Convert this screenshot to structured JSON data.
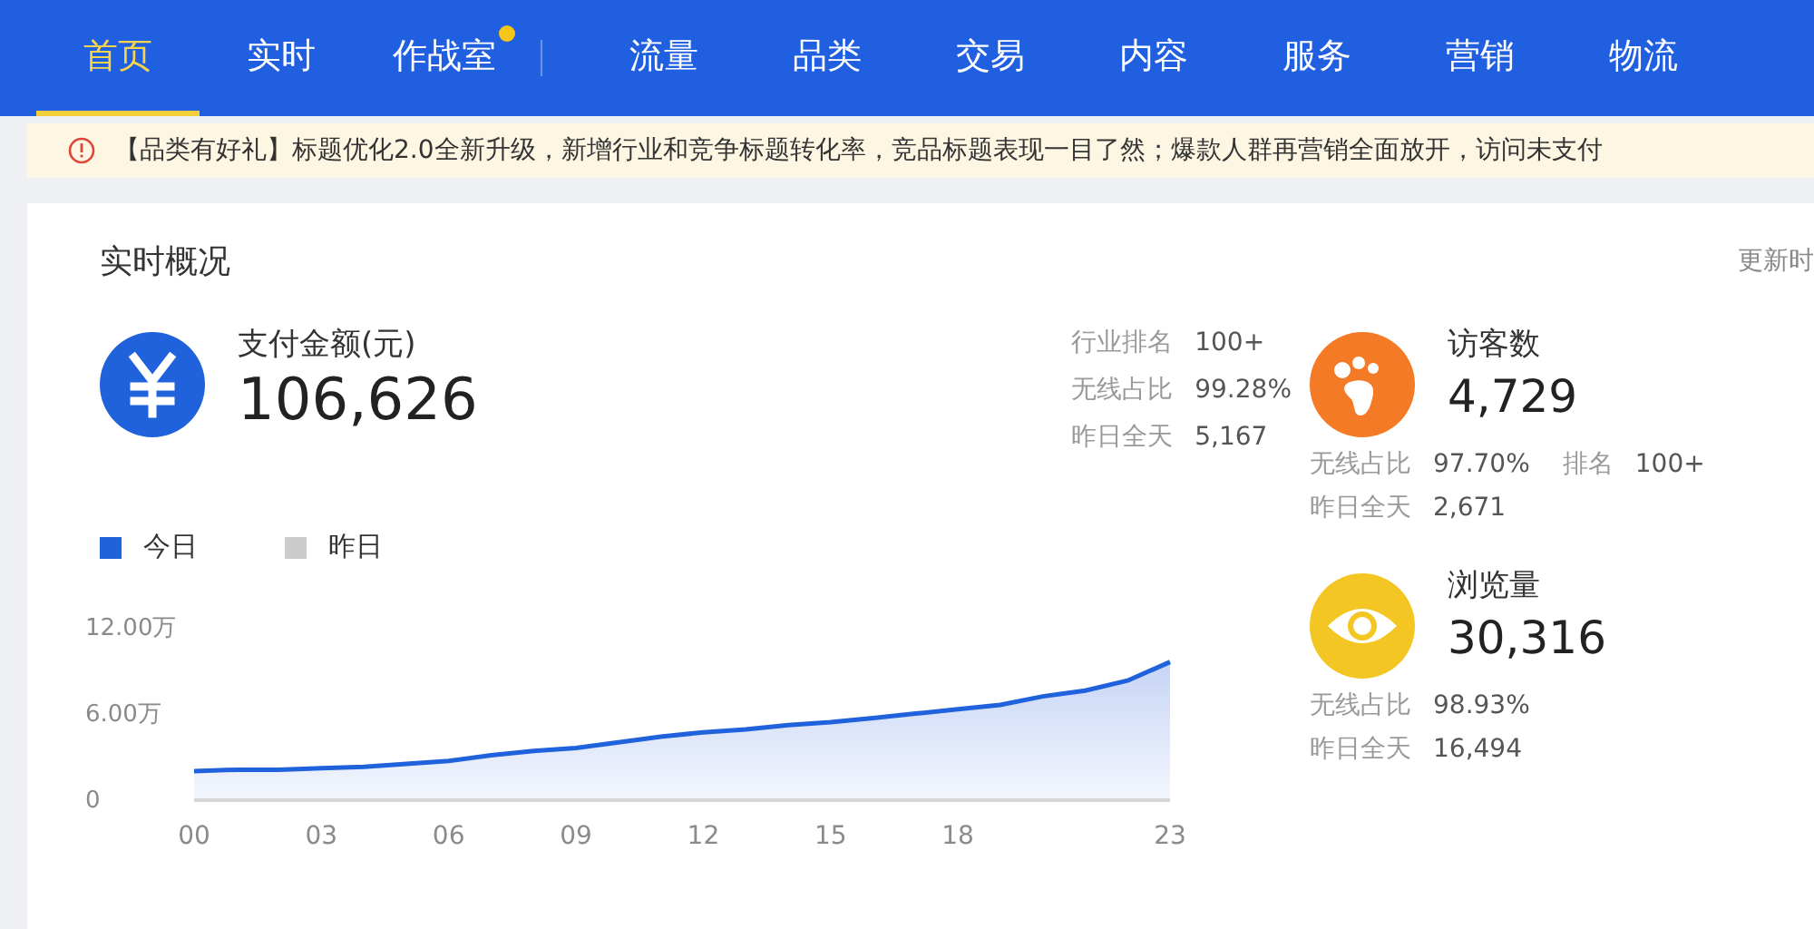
{
  "nav": [
    {
      "label": "首页",
      "selected": true,
      "dot": false
    },
    {
      "label": "实时",
      "selected": false,
      "dot": false
    },
    {
      "label": "作战室",
      "selected": false,
      "dot": true
    },
    {
      "label": "流量",
      "selected": false,
      "dot": false
    },
    {
      "label": "品类",
      "selected": false,
      "dot": false
    },
    {
      "label": "交易",
      "selected": false,
      "dot": false
    },
    {
      "label": "内容",
      "selected": false,
      "dot": false
    },
    {
      "label": "服务",
      "selected": false,
      "dot": false
    },
    {
      "label": "营销",
      "selected": false,
      "dot": false
    },
    {
      "label": "物流",
      "selected": false,
      "dot": false
    }
  ],
  "notice": {
    "text": "【品类有好礼】标题优化2.0全新升级，新增行业和竞争标题转化率，竞品标题表现一目了然；爆款人群再营销全面放开，访问未支付"
  },
  "overview": {
    "title": "实时概况",
    "update_time": "更新时",
    "main_metric": {
      "label": "支付金额(元)",
      "value": "106,626",
      "stats": [
        {
          "label": "行业排名",
          "value": "100+"
        },
        {
          "label": "无线占比",
          "value": "99.28%"
        },
        {
          "label": "昨日全天",
          "value": "5,167"
        }
      ]
    },
    "chart_data": {
      "type": "area",
      "x": [
        0,
        1,
        2,
        3,
        4,
        5,
        6,
        7,
        8,
        9,
        10,
        11,
        12,
        13,
        14,
        15,
        16,
        17,
        18,
        19,
        20,
        21,
        22,
        23
      ],
      "xlim": [
        0,
        23
      ],
      "xticks": [
        {
          "value": 0,
          "label": "00"
        },
        {
          "value": 3,
          "label": "03"
        },
        {
          "value": 6,
          "label": "06"
        },
        {
          "value": 9,
          "label": "09"
        },
        {
          "value": 12,
          "label": "12"
        },
        {
          "value": 15,
          "label": "15"
        },
        {
          "value": 18,
          "label": "18"
        },
        {
          "value": 23,
          "label": "23"
        }
      ],
      "yticks": [
        {
          "value": 0,
          "label": "0"
        },
        {
          "value": 6,
          "label": "6.00万"
        },
        {
          "value": 12,
          "label": "12.00万"
        }
      ],
      "ylim": [
        0,
        12
      ],
      "series": [
        {
          "name": "今日",
          "color": "#2062dc",
          "values": [
            1.9,
            2.0,
            2.0,
            2.1,
            2.2,
            2.4,
            2.6,
            3.0,
            3.3,
            3.5,
            3.9,
            4.3,
            4.6,
            4.8,
            5.1,
            5.3,
            5.6,
            5.9,
            6.2,
            6.5,
            7.1,
            7.5,
            8.2,
            9.5
          ]
        },
        {
          "name": "昨日",
          "color": "#cccccc",
          "values": [
            null,
            null,
            null,
            null,
            null,
            null,
            null,
            null,
            null,
            null,
            null,
            null,
            null,
            null,
            null,
            null,
            null,
            null,
            null,
            null,
            null,
            null,
            null,
            null
          ]
        }
      ]
    },
    "side_metrics": [
      {
        "kind": "visitors",
        "label": "访客数",
        "value": "4,729",
        "stats": [
          [
            {
              "label": "无线占比",
              "value": "97.70%"
            },
            {
              "label": "排名",
              "value": "100+"
            }
          ],
          [
            {
              "label": "昨日全天",
              "value": "2,671"
            }
          ]
        ]
      },
      {
        "kind": "pageviews",
        "label": "浏览量",
        "value": "30,316",
        "stats": [
          [
            {
              "label": "无线占比",
              "value": "98.93%"
            }
          ],
          [
            {
              "label": "昨日全天",
              "value": "16,494"
            }
          ]
        ]
      }
    ]
  }
}
